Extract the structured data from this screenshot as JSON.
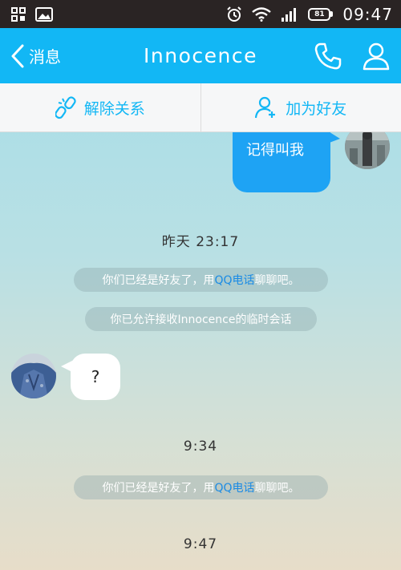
{
  "status_bar": {
    "time": "09:47",
    "battery_label": "81",
    "icons": [
      "grid-icon",
      "image-icon",
      "alarm-icon",
      "wifi-icon",
      "signal-icon",
      "battery-icon"
    ]
  },
  "header": {
    "back_label": "消息",
    "title": "Innocence",
    "icons": [
      "phone-icon",
      "profile-icon"
    ],
    "color": "#12b7f5"
  },
  "actions": [
    {
      "label": "解除关系",
      "icon": "unlink-icon"
    },
    {
      "label": "加为好友",
      "icon": "add-friend-icon"
    }
  ],
  "messages": {
    "outgoing_text": "记得叫我",
    "incoming_text": "?",
    "timestamps": [
      "昨天  23:17",
      "9:34",
      "9:47"
    ],
    "notice_friend": {
      "prefix": "你们已经是好友了，用",
      "link": "QQ电话",
      "suffix": "聊聊吧。"
    },
    "notice_temp_chat": "你已允许接收Innocence的临时会话"
  }
}
